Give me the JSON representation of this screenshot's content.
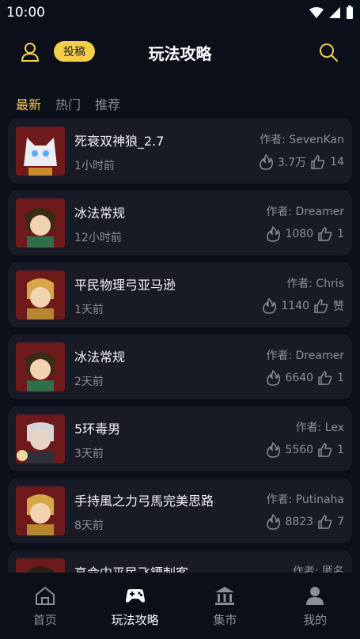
{
  "status_bar": {
    "time": "10:00"
  },
  "header": {
    "submit_label": "投稿",
    "title": "玩法攻略"
  },
  "tabs": [
    {
      "label": "最新",
      "active": true
    },
    {
      "label": "热门",
      "active": false
    },
    {
      "label": "推荐",
      "active": false
    }
  ],
  "posts": [
    {
      "title": "死衰双神狼_2.7",
      "author": "作者: SevenKan",
      "time": "1小时前",
      "heat": "3.7万",
      "likes": "14"
    },
    {
      "title": "冰法常规",
      "author": "作者: Dreamer",
      "time": "12小时前",
      "heat": "1080",
      "likes": "1"
    },
    {
      "title": "平民物理弓亚马逊",
      "author": "作者: Chris",
      "time": "1天前",
      "heat": "1140",
      "likes": "赞"
    },
    {
      "title": "冰法常规",
      "author": "作者: Dreamer",
      "time": "2天前",
      "heat": "6640",
      "likes": "1"
    },
    {
      "title": "5环毒男",
      "author": "作者: Lex",
      "time": "3天前",
      "heat": "5560",
      "likes": "1"
    },
    {
      "title": "手持風之力弓馬完美思路",
      "author": "作者: Putinaha",
      "time": "8天前",
      "heat": "8823",
      "likes": "7"
    },
    {
      "title": "高命中平民飞镖刺客",
      "author": "作者: 匿名",
      "time": "",
      "heat": "",
      "likes": ""
    }
  ],
  "nav": [
    {
      "label": "首页",
      "active": false
    },
    {
      "label": "玩法攻略",
      "active": true
    },
    {
      "label": "集市",
      "active": false
    },
    {
      "label": "我的",
      "active": false
    }
  ],
  "colors": {
    "accent": "#f3cf4a",
    "background": "#0b0f1a",
    "card": "#181b26",
    "muted": "#8b8d98"
  }
}
